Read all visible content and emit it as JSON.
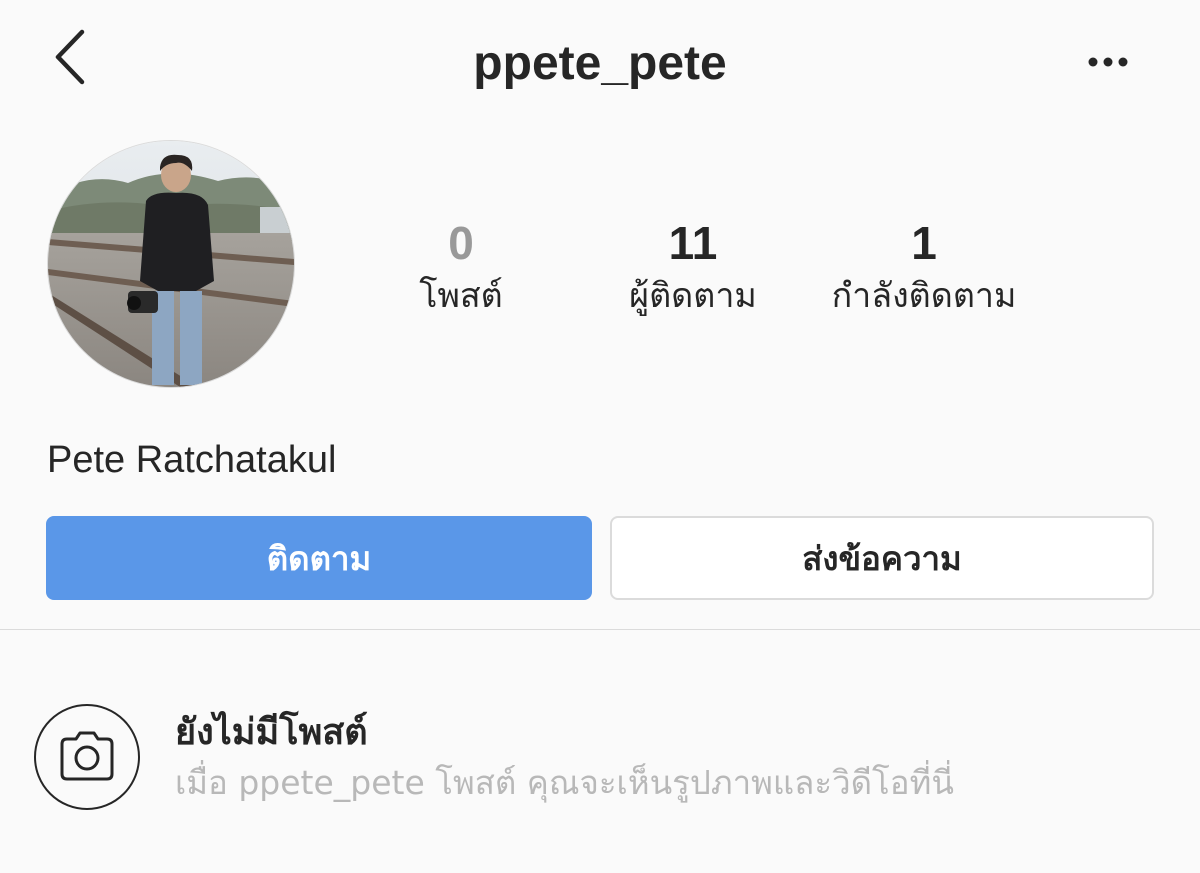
{
  "header": {
    "username": "ppete_pete",
    "back_icon": "chevron-left-icon",
    "more_icon": "more-horizontal-icon"
  },
  "profile": {
    "stats": [
      {
        "value": "0",
        "label": "โพสต์"
      },
      {
        "value": "11",
        "label": "ผู้ติดตาม"
      },
      {
        "value": "1",
        "label": "กำลังติดตาม"
      }
    ],
    "full_name": "Pete Ratchatakul"
  },
  "actions": {
    "follow_label": "ติดตาม",
    "message_label": "ส่งข้อความ"
  },
  "empty_state": {
    "icon": "camera-icon",
    "title": "ยังไม่มีโพสต์",
    "subtitle": "เมื่อ ppete_pete โพสต์ คุณจะเห็นรูปภาพและวิดีโอที่นี่"
  },
  "colors": {
    "background": "#fafafa",
    "primary_button": "#5a97e8",
    "text": "#262626",
    "muted_text": "#b8b8b8",
    "border": "#dbdbdb"
  }
}
